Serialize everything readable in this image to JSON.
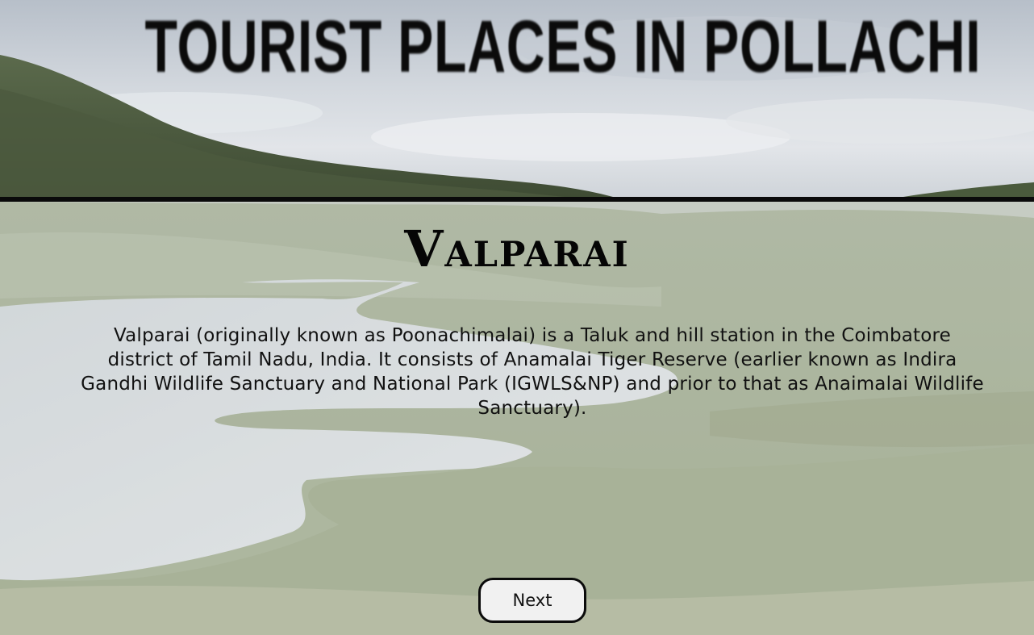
{
  "header": {
    "title": "TOURIST PLACES IN POLLACHI"
  },
  "place": {
    "name": "Valparai",
    "description": "Valparai (originally known as Poonachimalai) is a Taluk and hill station in the Coimbatore district of Tamil Nadu, India. It consists of Anamalai Tiger Reserve (earlier known as Indira Gandhi Wildlife Sanctuary and National Park (IGWLS&NP) and prior to that as Anaimalai Wildlife Sanctuary)."
  },
  "navigation": {
    "next_label": "Next"
  },
  "colors": {
    "title_text": "#0b0b0b",
    "divider": "#0a0a0a",
    "button_background": "#f1f1f1",
    "button_border": "#0b0b0b"
  }
}
